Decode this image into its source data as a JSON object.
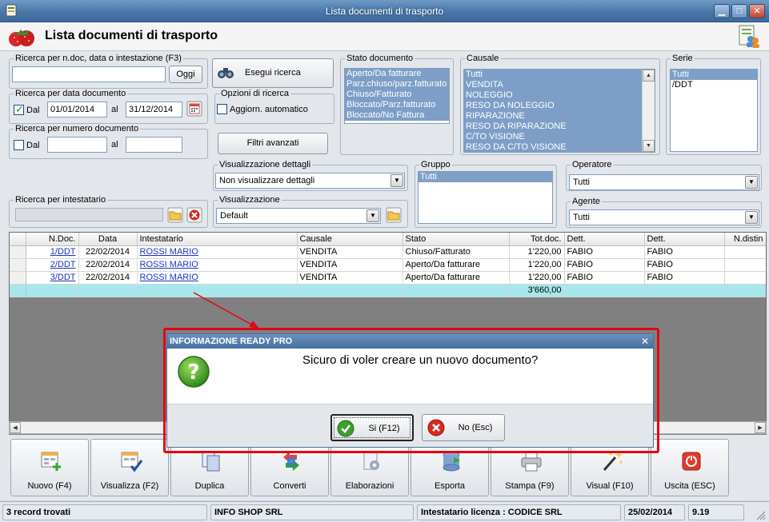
{
  "window": {
    "title": "Lista documenti di trasporto",
    "minimize_label": "▁",
    "maximize_label": "□",
    "close_label": "✕"
  },
  "header": {
    "title": "Lista documenti di trasporto"
  },
  "search": {
    "ndoc_group": "Ricerca per n.doc, data o intestazione (F3)",
    "ndoc_value": "",
    "oggi_label": "Oggi",
    "esegui_label": "Esegui ricerca",
    "data_group": "Ricerca per data documento",
    "data_dal_label": "Dal",
    "data_dal_value": "01/01/2014",
    "data_al_label": "al",
    "data_al_value": "31/12/2014",
    "data_dal_checked": true,
    "numero_group": "Ricerca per numero documento",
    "numero_dal_label": "Dal",
    "numero_dal_value": "",
    "numero_al_label": "al",
    "numero_al_value": "",
    "numero_dal_checked": false,
    "opzioni_group": "Opzioni di ricerca",
    "aggiorn_label": "Aggiorn. automatico",
    "aggiorn_checked": false,
    "filtri_label": "Filtri avanzati",
    "intestatario_group": "Ricerca per intestatario",
    "intestatario_value": ""
  },
  "stato": {
    "label": "Stato documento",
    "items": [
      "Aperto/Da fatturare",
      "Parz.chiuso/parz.fatturato",
      "Chiuso/Fatturato",
      "Bloccato/Parz.fatturato",
      "Bloccato/No Fattura"
    ]
  },
  "causale": {
    "label": "Causale",
    "items": [
      "Tutti",
      "VENDITA",
      "NOLEGGIO",
      "RESO DA NOLEGGIO",
      "RIPARAZIONE",
      "RESO DA RIPARAZIONE",
      "C/TO VISIONE",
      "RESO DA C/TO VISIONE"
    ]
  },
  "serie": {
    "label": "Serie",
    "items": [
      "Tutti",
      "/DDT"
    ]
  },
  "visualizzazione_dettagli": {
    "label": "Visualizzazione dettagli",
    "value": "Non visualizzare dettagli"
  },
  "visualizzazione": {
    "label": "Visualizzazione",
    "value": "Default"
  },
  "gruppo": {
    "label": "Gruppo",
    "items": [
      "Tutti"
    ]
  },
  "operatore": {
    "label": "Operatore",
    "value": "Tutti"
  },
  "agente": {
    "label": "Agente",
    "value": "Tutti"
  },
  "grid": {
    "columns": [
      "",
      "N.Doc.",
      "Data",
      "Intestatario",
      "Causale",
      "Stato",
      "Tot.doc.",
      "Dett.",
      "Dett.",
      "N.distin"
    ],
    "rows": [
      [
        "",
        "1/DDT",
        "22/02/2014",
        "ROSSI MARIO",
        "VENDITA",
        "Chiuso/Fatturato",
        "1'220,00",
        "FABIO",
        "FABIO",
        ""
      ],
      [
        "",
        "2/DDT",
        "22/02/2014",
        "ROSSI MARIO",
        "VENDITA",
        "Aperto/Da fatturare",
        "1'220,00",
        "FABIO",
        "FABIO",
        ""
      ],
      [
        "",
        "3/DDT",
        "22/02/2014",
        "ROSSI MARIO",
        "VENDITA",
        "Aperto/Da fatturare",
        "1'220,00",
        "FABIO",
        "FABIO",
        ""
      ]
    ],
    "total": "3'660,00"
  },
  "toolbar": {
    "buttons": [
      {
        "label": "Nuovo (F4)",
        "icon": "new-document-icon"
      },
      {
        "label": "Visualizza (F2)",
        "icon": "view-document-icon"
      },
      {
        "label": "Duplica",
        "icon": "duplicate-icon"
      },
      {
        "label": "Converti",
        "icon": "convert-icon"
      },
      {
        "label": "Elaborazioni",
        "icon": "process-icon"
      },
      {
        "label": "Esporta",
        "icon": "export-icon"
      },
      {
        "label": "Stampa (F9)",
        "icon": "printer-icon"
      },
      {
        "label": "Visual (F10)",
        "icon": "magic-wand-icon"
      },
      {
        "label": "Uscita (ESC)",
        "icon": "exit-icon"
      }
    ]
  },
  "status": {
    "records": "3 record trovati",
    "company": "INFO SHOP SRL",
    "license": "Intestatario licenza : CODICE SRL",
    "date": "25/02/2014",
    "version": "9.19"
  },
  "dialog": {
    "title": "INFORMAZIONE READY PRO",
    "close_label": "✕",
    "message": "Sicuro di voler creare un nuovo documento?",
    "yes_label": "Si (F12)",
    "no_label": "No (Esc)"
  },
  "colors": {
    "highlight": "#e30613",
    "selection": "#7d9fc7",
    "total_row": "#a7e7ec",
    "link": "#1b33c4"
  }
}
